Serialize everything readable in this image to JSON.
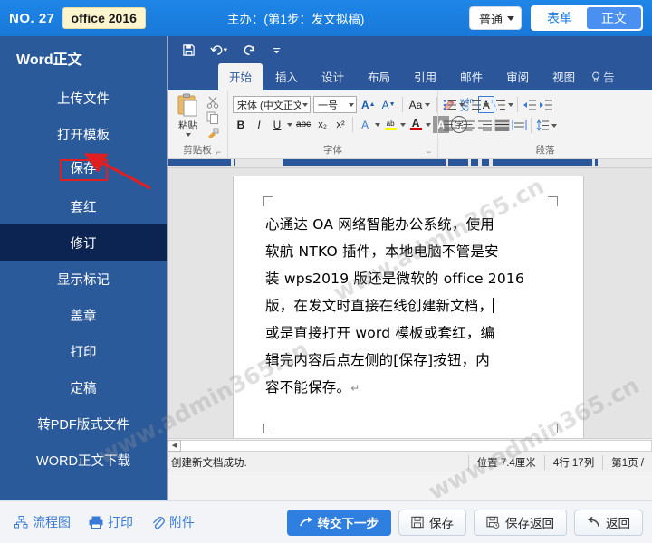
{
  "topbar": {
    "no_label": "NO. 27",
    "doc_chip": "office 2016",
    "title": "主办：(第1步：发文拟稿)",
    "mode_select": "普通",
    "tab_form": "表单",
    "tab_body": "正文",
    "accent": "#1878d8"
  },
  "sidebar": {
    "title": "Word正文",
    "items": [
      {
        "label": "上传文件",
        "state": "normal"
      },
      {
        "label": "打开模板",
        "state": "normal"
      },
      {
        "label": "保存",
        "state": "boxed"
      },
      {
        "label": "套红",
        "state": "normal"
      },
      {
        "label": "修订",
        "state": "active"
      },
      {
        "label": "显示标记",
        "state": "normal"
      },
      {
        "label": "盖章",
        "state": "normal"
      },
      {
        "label": "打印",
        "state": "normal"
      },
      {
        "label": "定稿",
        "state": "normal"
      },
      {
        "label": "转PDF版式文件",
        "state": "normal"
      },
      {
        "label": "WORD正文下载",
        "state": "normal"
      }
    ],
    "bg": "#2b5a9b",
    "active_bg": "#0c2452",
    "annotation_color": "#e02020"
  },
  "word": {
    "qat": {
      "save": "save-icon",
      "undo": "undo-icon",
      "redo": "redo-icon",
      "more": "more-icon"
    },
    "tabs": [
      {
        "label": "开始",
        "active": true
      },
      {
        "label": "插入",
        "active": false
      },
      {
        "label": "设计",
        "active": false
      },
      {
        "label": "布局",
        "active": false
      },
      {
        "label": "引用",
        "active": false
      },
      {
        "label": "邮件",
        "active": false
      },
      {
        "label": "审阅",
        "active": false
      },
      {
        "label": "视图",
        "active": false
      }
    ],
    "tell_me": "告",
    "groups": {
      "clipboard": {
        "label": "剪贴板",
        "paste": "粘贴",
        "cut": "cut-icon",
        "copy": "copy-icon",
        "format_painter": "format-painter-icon"
      },
      "font": {
        "label": "字体",
        "font_name": "宋体 (中文正文)",
        "font_size": "一号",
        "grow": "A",
        "shrink": "A",
        "change_case": "Aa",
        "clear_format": "clear-format-icon",
        "phonetic": "拼音指南",
        "char_border": "A",
        "bold": "B",
        "italic": "I",
        "underline": "U",
        "strikethrough": "abc",
        "subscript": "x₂",
        "superscript": "x²",
        "text_effects": "A",
        "highlight": "ab",
        "font_color": "A",
        "char_shading": "A",
        "enclose_char": "字"
      },
      "paragraph": {
        "label": "段落",
        "bullets": "bullet-list-icon",
        "numbering": "numbered-list-icon",
        "multilevel": "multilevel-list-icon",
        "decrease_indent": "decrease-indent-icon",
        "increase_indent": "increase-indent-icon",
        "align_left": "align-left-icon",
        "align_center": "align-center-icon",
        "align_right": "align-right-icon",
        "justify": "justify-icon",
        "distribute": "distribute-icon",
        "line_spacing": "line-spacing-icon"
      }
    },
    "document": {
      "lines": [
        "心通达 OA 网络智能办公系统，使用",
        "软航 NTKO 插件，本地电脑不管是安",
        "装 wps2019 版还是微软的 office 2016",
        "版，在发文时直接在线创建新文档，",
        "或是直接打开 word 模板或套红，编",
        "辑完内容后点左侧的[保存]按钮，内",
        "容不能保存。"
      ]
    },
    "status": {
      "message": "创建新文档成功.",
      "position": "位置 7.4厘米",
      "line_col": "4行 17列",
      "page": "第1页 /"
    }
  },
  "bottombar": {
    "links": [
      {
        "label": "流程图",
        "icon": "flowchart-icon"
      },
      {
        "label": "打印",
        "icon": "printer-icon"
      },
      {
        "label": "附件",
        "icon": "paperclip-icon"
      }
    ],
    "buttons": [
      {
        "label": "转交下一步",
        "icon": "forward-arrow-icon",
        "primary": true
      },
      {
        "label": "保存",
        "icon": "save-icon",
        "primary": false
      },
      {
        "label": "保存返回",
        "icon": "save-return-icon",
        "primary": false
      },
      {
        "label": "返回",
        "icon": "back-arrow-icon",
        "primary": false
      }
    ],
    "primary_color": "#2f7fe0"
  },
  "watermark": {
    "text": "www.admin365.cn"
  }
}
